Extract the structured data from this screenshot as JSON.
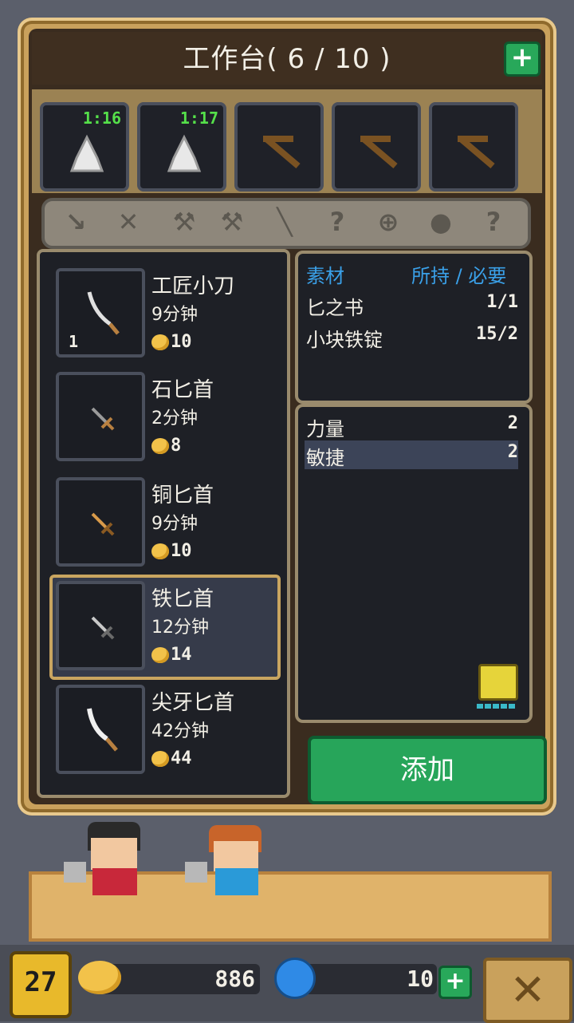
{
  "header": {
    "title": "工作台( 6 / 10 )",
    "add_icon": "plus-icon"
  },
  "queue": [
    {
      "timer": "1:16",
      "icon": "cloth-icon"
    },
    {
      "timer": "1:17",
      "icon": "cloth-icon"
    },
    {
      "timer": "",
      "icon": "crossbow-icon"
    },
    {
      "timer": "",
      "icon": "crossbow-icon"
    },
    {
      "timer": "",
      "icon": "crossbow-icon"
    }
  ],
  "categories": [
    "dagger-icon",
    "sword-icon",
    "axe-icon",
    "hammer-icon",
    "staff-icon",
    "question-icon",
    "bow-icon",
    "pot-icon",
    "question-icon"
  ],
  "recipes": [
    {
      "name": "工匠小刀",
      "time": "9分钟",
      "cost": "10",
      "count": "1"
    },
    {
      "name": "石匕首",
      "time": "2分钟",
      "cost": "8",
      "count": ""
    },
    {
      "name": "铜匕首",
      "time": "9分钟",
      "cost": "10",
      "count": ""
    },
    {
      "name": "铁匕首",
      "time": "12分钟",
      "cost": "14",
      "count": ""
    },
    {
      "name": "尖牙匕首",
      "time": "42分钟",
      "cost": "44",
      "count": ""
    }
  ],
  "materials": {
    "header_left": "素材",
    "header_right": "所持 / 必要",
    "rows": [
      {
        "name": "匕之书",
        "value": "1/1"
      },
      {
        "name": "小块铁锭",
        "value": "15/2"
      }
    ]
  },
  "stats": [
    {
      "name": "力量",
      "value": "2"
    },
    {
      "name": "敏捷",
      "value": "2"
    }
  ],
  "add_button": "添加",
  "footer": {
    "level": "27",
    "gold": "886",
    "gems": "10"
  },
  "colors": {
    "accent_green": "#27a55a",
    "frame_gold": "#c9a15c",
    "timer_green": "#55e04a",
    "header_blue": "#3aa0e8"
  }
}
